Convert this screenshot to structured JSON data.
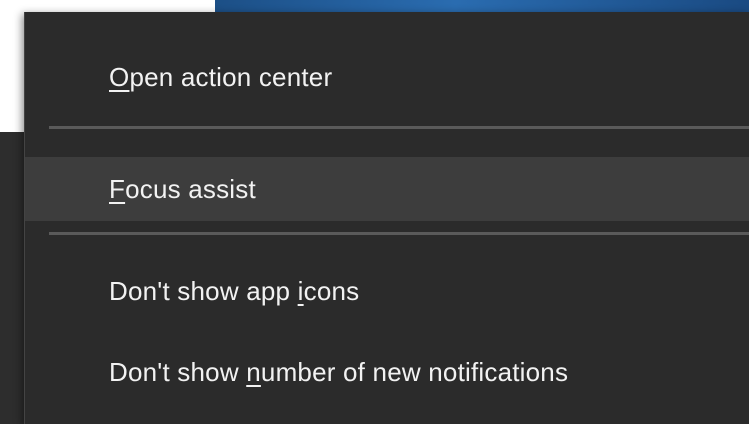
{
  "menu": {
    "items": [
      {
        "pre": "",
        "key": "O",
        "post": "pen action center"
      },
      {
        "pre": "",
        "key": "F",
        "post": "ocus assist"
      },
      {
        "pre": "Don't show app ",
        "key": "i",
        "post": "cons"
      },
      {
        "pre": "Don't show ",
        "key": "n",
        "post": "umber of new notifications"
      }
    ],
    "highlighted_item": "Focus assist"
  },
  "colors": {
    "menu_background": "#2b2b2b",
    "hover_background": "#3d3d3d",
    "separator": "#5a5a5a",
    "text": "#f2f2f2",
    "desktop_accent": "#2a6cb0"
  }
}
